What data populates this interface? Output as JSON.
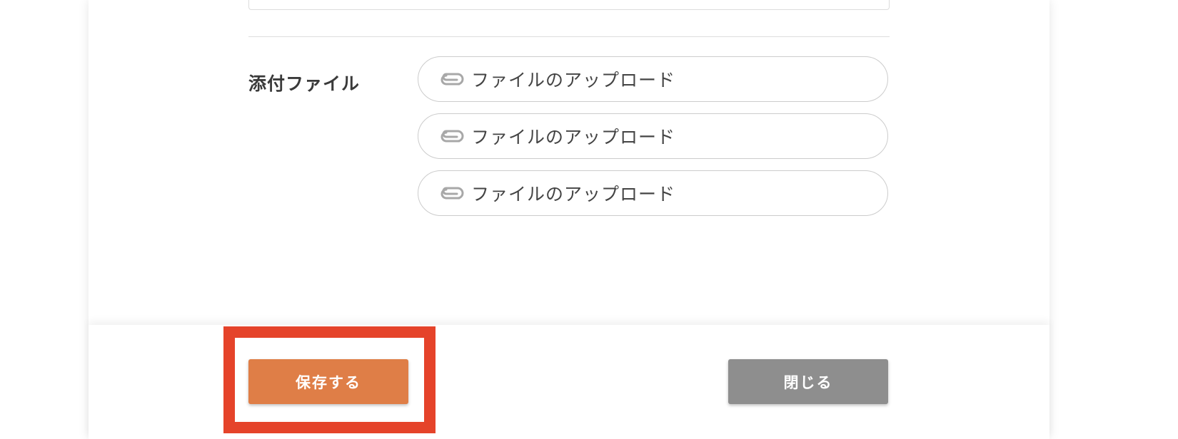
{
  "attachments": {
    "label": "添付ファイル",
    "uploads": [
      {
        "label": "ファイルのアップロード",
        "icon": "paperclip-icon"
      },
      {
        "label": "ファイルのアップロード",
        "icon": "paperclip-icon"
      },
      {
        "label": "ファイルのアップロード",
        "icon": "paperclip-icon"
      }
    ]
  },
  "footer": {
    "save_label": "保存する",
    "close_label": "閉じる"
  },
  "colors": {
    "save_button": "#df7e47",
    "close_button": "#8e8e8e",
    "highlight": "#e5432a",
    "icon": "#a8a8a8"
  }
}
